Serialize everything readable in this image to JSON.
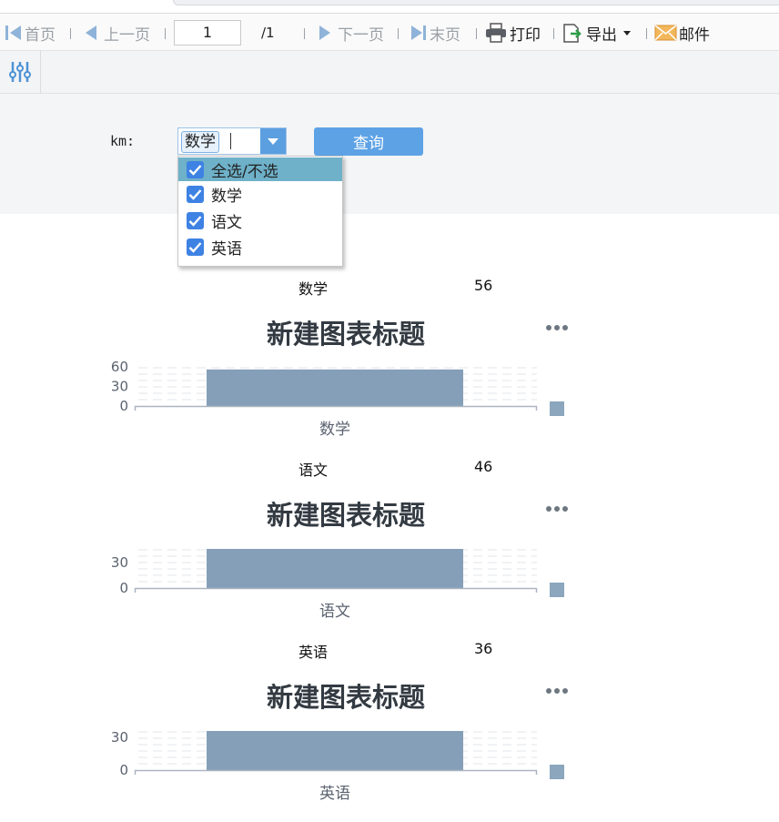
{
  "toolbar": {
    "first_page": "首页",
    "prev_page": "上一页",
    "page_value": "1",
    "total_pages": "/1",
    "next_page": "下一页",
    "last_page": "末页",
    "print": "打印",
    "export": "导出",
    "mail": "邮件"
  },
  "params": {
    "km_label": "km:",
    "selected_tag": "数学",
    "query_button": "查询",
    "dropdown_items": [
      {
        "label": "全选/不选",
        "checked": true
      },
      {
        "label": "数学",
        "checked": true
      },
      {
        "label": "语文",
        "checked": true
      },
      {
        "label": "英语",
        "checked": true
      }
    ]
  },
  "colors": {
    "bar": "#859fb8",
    "accent": "#5ea2e6",
    "checkbox": "#3e82e4"
  },
  "reports": [
    {
      "subject": "数学",
      "score": "56"
    },
    {
      "subject": "语文",
      "score": "46"
    },
    {
      "subject": "英语",
      "score": "36"
    }
  ],
  "chart_data": [
    {
      "type": "bar",
      "title": "新建图表标题",
      "categories": [
        "数学"
      ],
      "values": [
        56
      ],
      "yticks": [
        0,
        30,
        60
      ],
      "ylim": [
        0,
        60
      ],
      "legend": "right"
    },
    {
      "type": "bar",
      "title": "新建图表标题",
      "categories": [
        "语文"
      ],
      "values": [
        46
      ],
      "yticks": [
        0,
        30
      ],
      "ylim": [
        0,
        46
      ],
      "legend": "right"
    },
    {
      "type": "bar",
      "title": "新建图表标题",
      "categories": [
        "英语"
      ],
      "values": [
        36
      ],
      "yticks": [
        0,
        30
      ],
      "ylim": [
        0,
        36
      ],
      "legend": "right"
    }
  ]
}
